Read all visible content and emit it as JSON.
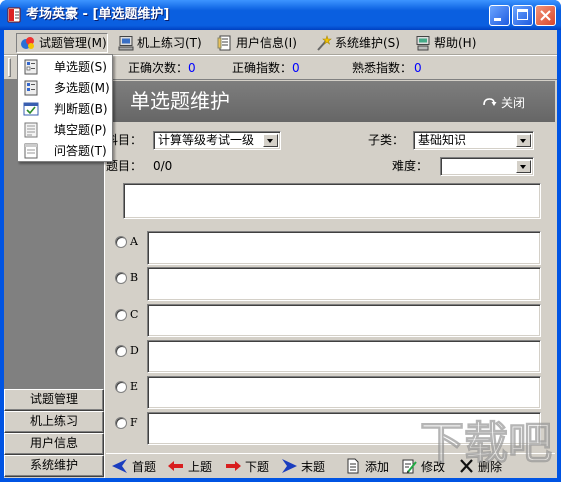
{
  "window": {
    "title": "考场英豪 - [单选题维护]",
    "app_icon": "app-icon"
  },
  "menubar": {
    "items": [
      {
        "label": "试题管理(M)",
        "icon": "quiz-manage-icon",
        "open": true
      },
      {
        "label": "机上练习(T)",
        "icon": "practice-icon"
      },
      {
        "label": "用户信息(I)",
        "icon": "user-info-icon"
      },
      {
        "label": "系统维护(S)",
        "icon": "system-icon"
      },
      {
        "label": "帮助(H)",
        "icon": "help-icon"
      }
    ]
  },
  "dropdown": {
    "items": [
      {
        "label": "单选题(S)",
        "icon": "single-choice-icon"
      },
      {
        "label": "多选题(M)",
        "icon": "multiple-choice-icon"
      },
      {
        "label": "判断题(B)",
        "icon": "true-false-icon"
      },
      {
        "label": "填空题(P)",
        "icon": "fill-blank-icon"
      },
      {
        "label": "问答题(T)",
        "icon": "essay-icon"
      }
    ]
  },
  "stats": [
    {
      "label": "正确次数：",
      "value": "0"
    },
    {
      "label": "正确指数：",
      "value": "0"
    },
    {
      "label": "熟悉指数：",
      "value": "0"
    }
  ],
  "sidebar": {
    "buttons": [
      "试题管理",
      "机上练习",
      "用户信息",
      "系统维护"
    ]
  },
  "panel": {
    "title": "单选题维护",
    "close_label": "关闭",
    "close_icon": "close-arrow-icon"
  },
  "form": {
    "subject": {
      "label": "科目：",
      "value": "计算等级考试一级"
    },
    "subcategory": {
      "label": "子类：",
      "value": "基础知识"
    },
    "question": {
      "label": "题目：",
      "count": "0/0"
    },
    "difficulty": {
      "label": "难度："
    },
    "options": [
      "A",
      "B",
      "C",
      "D",
      "E",
      "F"
    ]
  },
  "toolbar": {
    "buttons": [
      {
        "label": "首题",
        "icon": "first-arrow-icon"
      },
      {
        "label": "上题",
        "icon": "prev-arrow-icon"
      },
      {
        "label": "下题",
        "icon": "next-arrow-icon"
      },
      {
        "label": "末题",
        "icon": "last-arrow-icon"
      },
      {
        "label": "添加",
        "icon": "add-icon"
      },
      {
        "label": "修改",
        "icon": "edit-icon"
      },
      {
        "label": "删除",
        "icon": "delete-icon"
      }
    ]
  },
  "watermark": "下载吧",
  "colors": {
    "title_bar": "#0A5FE0",
    "frame": "#0054E3",
    "close_button": "#D9472B",
    "chrome_bg": "#D4D0C8",
    "form_bg": "#D4D0C8",
    "sidebar_bg": "#808080",
    "header_bg": "#666666",
    "value_text": "#0000FF"
  }
}
